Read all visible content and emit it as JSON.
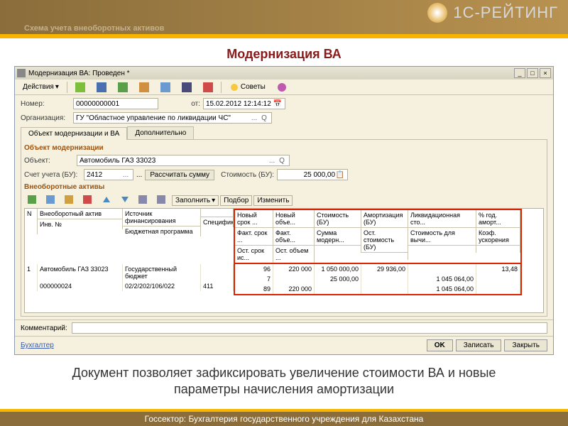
{
  "branding": {
    "logo_text": "1С-РЕЙТИНГ",
    "subtitle": "Схема учета внеоборотных активов"
  },
  "page": {
    "title": "Модернизация ВА"
  },
  "window": {
    "title": "Модернизация ВА: Проведен *"
  },
  "toolbar": {
    "actions_label": "Действия",
    "advice_label": "Советы"
  },
  "form": {
    "number_label": "Номер:",
    "number_value": "00000000001",
    "from_label": "от:",
    "date_value": "15.02.2012 12:14:12",
    "org_label": "Организация:",
    "org_value": "ГУ \"Областное управление по ликвидации ЧС\""
  },
  "tabs": {
    "tab1": "Объект модернизации и ВА",
    "tab2": "Дополнительно"
  },
  "section1": {
    "title": "Объект модернизации",
    "object_label": "Объект:",
    "object_value": "Автомобиль ГАЗ 33023",
    "account_label": "Счет учета (БУ):",
    "account_value": "2412",
    "calc_btn": "Рассчитать сумму",
    "cost_label": "Стоимость (БУ):",
    "cost_value": "25 000,00"
  },
  "section2": {
    "title": "Внеоборотные активы",
    "gridbar": {
      "fill": "Заполнить",
      "select": "Подбор",
      "edit": "Изменить"
    },
    "headers": {
      "n": "N",
      "asset": "Внеоборотный актив",
      "inv": "Инв. №",
      "finsrc": "Источник финансирования",
      "budprog": "Бюджетная программа",
      "spec": "Специфика",
      "new_term": "Новый срок ...",
      "fact_term": "Факт. срок ...",
      "ost_term": "Ост. срок ис...",
      "new_vol": "Новый объе...",
      "fact_vol": "Факт. объе...",
      "ost_vol": "Ост. объем ...",
      "cost_bu": "Стоимость (БУ)",
      "sum_mod": "Сумма модерн...",
      "amort": "Амортизация (БУ)",
      "ost_st": "Ост. стоимость (БУ)",
      "liq": "Ликвидационная сто...",
      "calc_cost": "Стоимость для вычи...",
      "pct": "% год. аморт...",
      "koef": "Коэф. ускорения"
    },
    "rows": [
      {
        "n": "1",
        "asset": "Автомобиль ГАЗ 33023",
        "inv": "000000024",
        "finsrc": "Государственный бюджет",
        "budprog": "02/2/202/106/022",
        "spec": "411",
        "new_term": "96",
        "fact_term": "7",
        "ost_term": "89",
        "new_vol": "220 000",
        "fact_vol": "",
        "ost_vol": "220 000",
        "cost_bu": "1 050 000,00",
        "sum_mod": "25 000,00",
        "amort": "29 936,00",
        "ost_st": "",
        "liq": "",
        "calc_cost": "1 045 064,00",
        "calc_cost2": "1 045 064,00",
        "pct": "13,48",
        "koef": ""
      }
    ]
  },
  "comment": {
    "label": "Комментарий:"
  },
  "statusbar": {
    "user": "Бухгалтер",
    "ok": "OK",
    "save": "Записать",
    "close": "Закрыть"
  },
  "caption": "Документ позволяет зафиксировать увеличение стоимости ВА и новые параметры начисления амортизации",
  "footer": "Госсектор: Бухгалтерия государственного учреждения для Казахстана"
}
